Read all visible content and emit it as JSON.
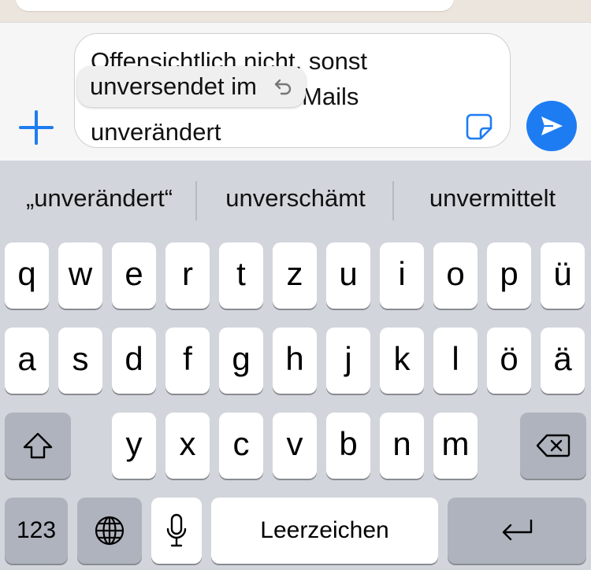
{
  "colors": {
    "accent": "#1d7cf2",
    "keyboard_bg": "#d2d5db",
    "key_bg": "#ffffff",
    "special_key_bg": "#aeb3bd"
  },
  "composer": {
    "text_line1": "Offensichtlich nicht, sonst",
    "text_line2_tail": "Mails",
    "text_line3": "unverändert",
    "plus_icon": "plus-icon",
    "sticker_icon": "sticker-icon",
    "send_icon": "send-icon"
  },
  "undo_popup": {
    "text": "unversendet im",
    "icon": "undo-icon"
  },
  "suggestions": [
    "„unverändert“",
    "unverschämt",
    "unvermittelt"
  ],
  "keyboard": {
    "row1": [
      "q",
      "w",
      "e",
      "r",
      "t",
      "z",
      "u",
      "i",
      "o",
      "p",
      "ü"
    ],
    "row2": [
      "a",
      "s",
      "d",
      "f",
      "g",
      "h",
      "j",
      "k",
      "l",
      "ö",
      "ä"
    ],
    "row3": [
      "y",
      "x",
      "c",
      "v",
      "b",
      "n",
      "m"
    ],
    "numbers_label": "123",
    "space_label": "Leerzeichen",
    "shift_icon": "shift-icon",
    "delete_icon": "delete-icon",
    "globe_icon": "globe-icon",
    "mic_icon": "mic-icon",
    "return_icon": "return-icon"
  }
}
